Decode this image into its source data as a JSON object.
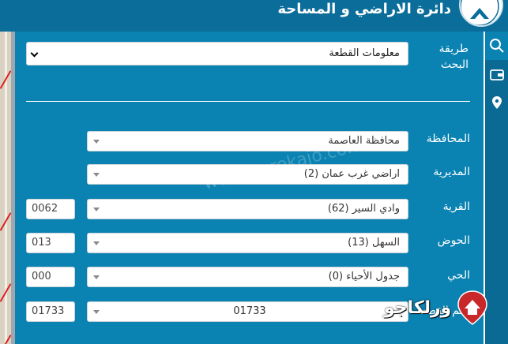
{
  "header": {
    "title": "دائرة الاراضي و المساحة",
    "logo_icon": "dls-logo-icon"
  },
  "tabs": [
    {
      "name": "search",
      "icon": "search-icon",
      "active": true
    },
    {
      "name": "wallet",
      "icon": "wallet-icon",
      "active": false
    },
    {
      "name": "location",
      "icon": "location-pin-icon",
      "active": false
    }
  ],
  "search_method": {
    "label": "طريقة البحث",
    "value": "معلومات القطعة"
  },
  "fields": {
    "governorate": {
      "label": "المحافظة",
      "value": "محافظة العاصمة"
    },
    "directorate": {
      "label": "المديرية",
      "value": "اراضي غرب عمان (2)"
    },
    "village": {
      "label": "القرية",
      "value": "وادي السير (62)",
      "code": "0062"
    },
    "basin": {
      "label": "الحوض",
      "value": "السهل (13)",
      "code": "013"
    },
    "district": {
      "label": "الحي",
      "value": "جدول الأحياء (0)",
      "code": "000"
    },
    "parcel": {
      "label": "رقم القطعة",
      "value": "01733",
      "code": "01733"
    }
  },
  "watermark": "www.eurekajo.com",
  "brand": {
    "text": "ورلكاجو"
  },
  "colors": {
    "panel": "#0a82b2",
    "header": "#0b6d99",
    "tabs": "#0a6a94"
  }
}
